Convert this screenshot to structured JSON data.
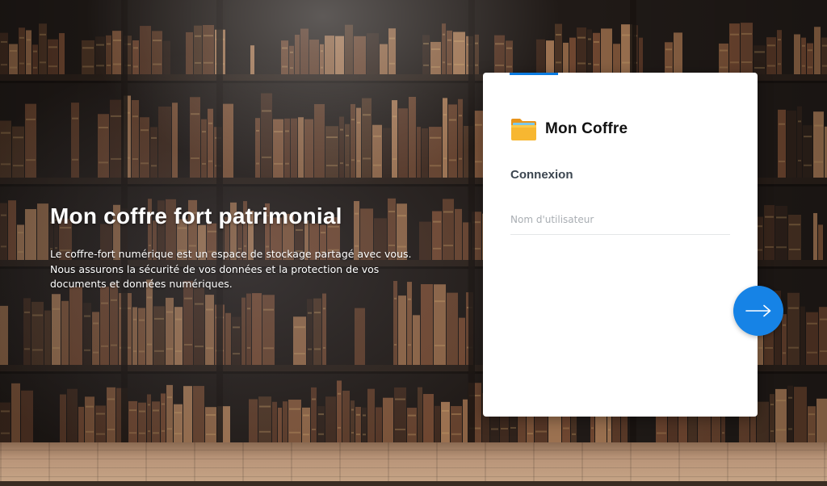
{
  "hero": {
    "title": "Mon coffre fort patrimonial",
    "description_lines": [
      "Le coffre-fort numérique est un espace de stockage partagé avec vous.",
      "Nous assurons la sécurité de vos données et la protection de vos",
      "documents et données numériques."
    ]
  },
  "login": {
    "brand_icon": "folder-icon",
    "brand_name": "Mon Coffre",
    "section_title": "Connexion",
    "username_placeholder": "Nom d'utilisateur",
    "username_value": "",
    "submit_icon": "arrow-right-icon"
  },
  "colors": {
    "accent": "#0a7be0",
    "submit_button": "#1683e6",
    "folder": "#f5a623"
  }
}
